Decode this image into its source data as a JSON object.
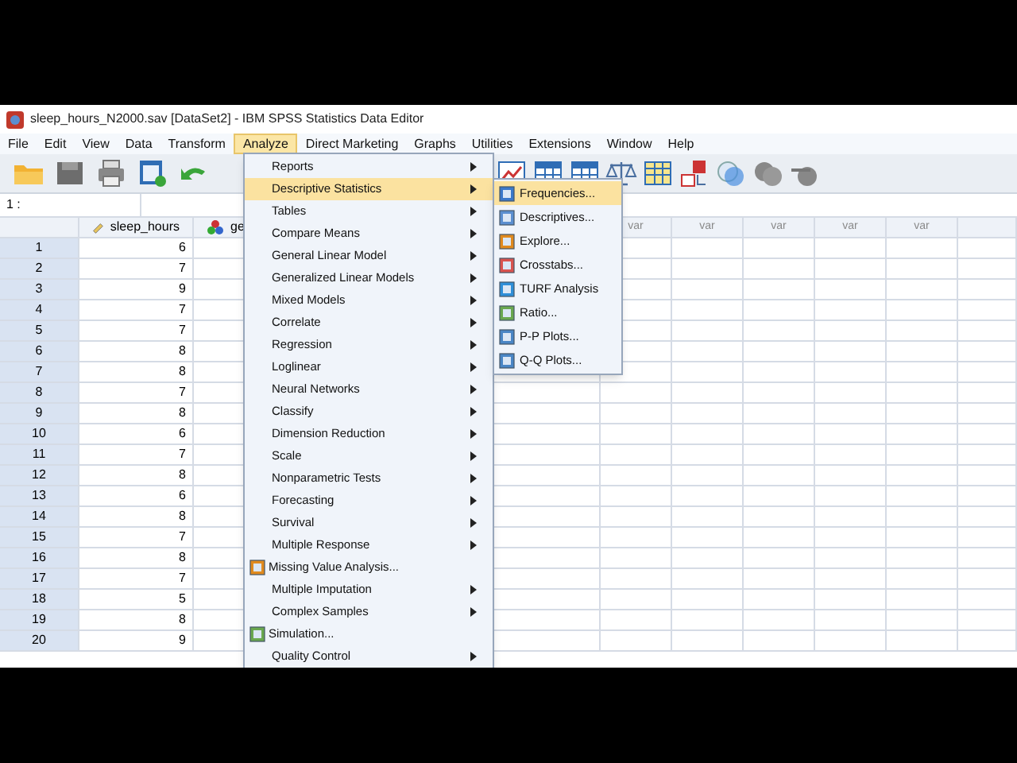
{
  "window": {
    "title": "sleep_hours_N2000.sav [DataSet2] - IBM SPSS Statistics Data Editor"
  },
  "menu_bar": [
    {
      "label": "File",
      "selected": false
    },
    {
      "label": "Edit",
      "selected": false
    },
    {
      "label": "View",
      "selected": false
    },
    {
      "label": "Data",
      "selected": false
    },
    {
      "label": "Transform",
      "selected": false
    },
    {
      "label": "Analyze",
      "selected": true
    },
    {
      "label": "Direct Marketing",
      "selected": false
    },
    {
      "label": "Graphs",
      "selected": false
    },
    {
      "label": "Utilities",
      "selected": false
    },
    {
      "label": "Extensions",
      "selected": false
    },
    {
      "label": "Window",
      "selected": false
    },
    {
      "label": "Help",
      "selected": false
    }
  ],
  "cell_reference": "1 :",
  "grid": {
    "columns": [
      {
        "label": "sleep_hours",
        "kind": "scale"
      },
      {
        "label": "ge",
        "kind": "nominal"
      }
    ],
    "var_columns": [
      "var",
      "var",
      "var",
      "var",
      "var"
    ],
    "rows": [
      {
        "number": "1",
        "value": "6"
      },
      {
        "number": "2",
        "value": "7"
      },
      {
        "number": "3",
        "value": "9"
      },
      {
        "number": "4",
        "value": "7"
      },
      {
        "number": "5",
        "value": "7"
      },
      {
        "number": "6",
        "value": "8"
      },
      {
        "number": "7",
        "value": "8"
      },
      {
        "number": "8",
        "value": "7"
      },
      {
        "number": "9",
        "value": "8"
      },
      {
        "number": "10",
        "value": "6"
      },
      {
        "number": "11",
        "value": "7"
      },
      {
        "number": "12",
        "value": "8"
      },
      {
        "number": "13",
        "value": "6"
      },
      {
        "number": "14",
        "value": "8"
      },
      {
        "number": "15",
        "value": "7"
      },
      {
        "number": "16",
        "value": "8"
      },
      {
        "number": "17",
        "value": "7"
      },
      {
        "number": "18",
        "value": "5"
      },
      {
        "number": "19",
        "value": "8"
      },
      {
        "number": "20",
        "value": "9"
      }
    ]
  },
  "analyze_menu": [
    {
      "label": "Reports",
      "kind": "submenu",
      "selected": false
    },
    {
      "label": "Descriptive Statistics",
      "kind": "submenu",
      "selected": true
    },
    {
      "label": "Tables",
      "kind": "submenu",
      "selected": false
    },
    {
      "label": "Compare Means",
      "kind": "submenu",
      "selected": false
    },
    {
      "label": "General Linear Model",
      "kind": "submenu",
      "selected": false
    },
    {
      "label": "Generalized Linear Models",
      "kind": "submenu",
      "selected": false
    },
    {
      "label": "Mixed Models",
      "kind": "submenu",
      "selected": false
    },
    {
      "label": "Correlate",
      "kind": "submenu",
      "selected": false
    },
    {
      "label": "Regression",
      "kind": "submenu",
      "selected": false
    },
    {
      "label": "Loglinear",
      "kind": "submenu",
      "selected": false
    },
    {
      "label": "Neural Networks",
      "kind": "submenu",
      "selected": false
    },
    {
      "label": "Classify",
      "kind": "submenu",
      "selected": false
    },
    {
      "label": "Dimension Reduction",
      "kind": "submenu",
      "selected": false
    },
    {
      "label": "Scale",
      "kind": "submenu",
      "selected": false
    },
    {
      "label": "Nonparametric Tests",
      "kind": "submenu",
      "selected": false
    },
    {
      "label": "Forecasting",
      "kind": "submenu",
      "selected": false
    },
    {
      "label": "Survival",
      "kind": "submenu",
      "selected": false
    },
    {
      "label": "Multiple Response",
      "kind": "submenu",
      "selected": false
    },
    {
      "label": "Missing Value Analysis...",
      "kind": "dialog",
      "selected": false
    },
    {
      "label": "Multiple Imputation",
      "kind": "submenu",
      "selected": false
    },
    {
      "label": "Complex Samples",
      "kind": "submenu",
      "selected": false
    },
    {
      "label": "Simulation...",
      "kind": "dialog",
      "selected": false
    },
    {
      "label": "Quality Control",
      "kind": "submenu",
      "selected": false
    }
  ],
  "descriptive_submenu": [
    {
      "label": "Frequencies...",
      "selected": true
    },
    {
      "label": "Descriptives...",
      "selected": false
    },
    {
      "label": "Explore...",
      "selected": false
    },
    {
      "label": "Crosstabs...",
      "selected": false
    },
    {
      "label": "TURF Analysis",
      "selected": false
    },
    {
      "label": "Ratio...",
      "selected": false
    },
    {
      "label": "P-P Plots...",
      "selected": false
    },
    {
      "label": "Q-Q Plots...",
      "selected": false
    }
  ]
}
